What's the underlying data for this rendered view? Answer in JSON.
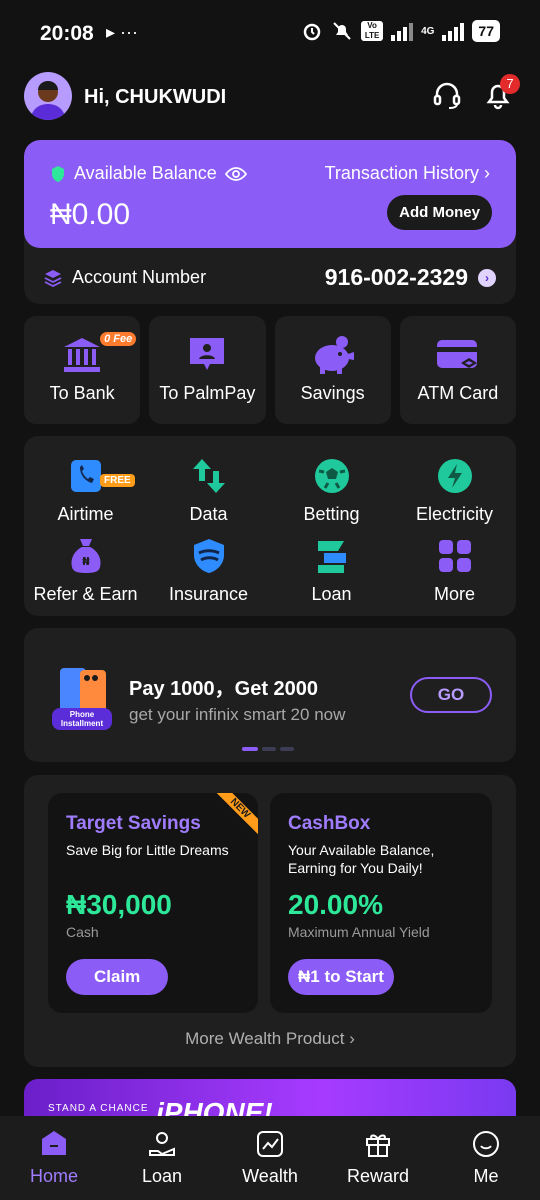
{
  "status_bar": {
    "time": "20:08",
    "battery": "77",
    "network": "4G",
    "volte": "Vo LTE"
  },
  "header": {
    "greeting": "Hi, CHUKWUDI",
    "notification_count": "7"
  },
  "balance": {
    "label": "Available Balance",
    "amount": "₦0.00",
    "history_link": "Transaction History",
    "add_money": "Add Money",
    "account_label": "Account Number",
    "account_number": "916-002-2329"
  },
  "quick_actions": [
    {
      "label": "To Bank",
      "tag": "0 Fee"
    },
    {
      "label": "To PalmPay"
    },
    {
      "label": "Savings"
    },
    {
      "label": "ATM Card"
    }
  ],
  "services": [
    {
      "label": "Airtime",
      "tag": "FREE"
    },
    {
      "label": "Data"
    },
    {
      "label": "Betting"
    },
    {
      "label": "Electricity"
    },
    {
      "label": "Refer & Earn"
    },
    {
      "label": "Insurance"
    },
    {
      "label": "Loan"
    },
    {
      "label": "More"
    }
  ],
  "promo": {
    "title": "Pay 1000，Get 2000",
    "subtitle": "get your infinix smart 20 now",
    "button": "GO",
    "image_tag": "Phone Installment"
  },
  "wealth": {
    "cards": [
      {
        "title": "Target Savings",
        "desc": "Save Big for Little Dreams",
        "value": "₦30,000",
        "sub": "Cash",
        "button": "Claim",
        "ribbon": "NEW"
      },
      {
        "title": "CashBox",
        "desc": "Your Available Balance, Earning for You Daily!",
        "value": "20.00%",
        "sub": "Maximum Annual Yield",
        "button": "₦1 to Start"
      }
    ],
    "more": "More Wealth Product"
  },
  "banner": {
    "small": "STAND A CHANCE",
    "big": "iPHONE!"
  },
  "nav": [
    {
      "label": "Home",
      "active": true
    },
    {
      "label": "Loan"
    },
    {
      "label": "Wealth"
    },
    {
      "label": "Reward"
    },
    {
      "label": "Me"
    }
  ],
  "colors": {
    "accent": "#8c5cf6",
    "green": "#2ee89a",
    "bg": "#121212",
    "card": "#1f1f1f"
  }
}
